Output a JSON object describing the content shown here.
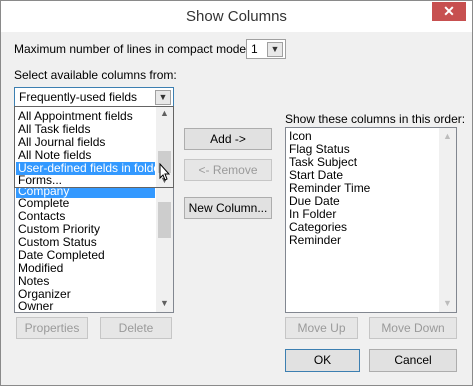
{
  "window": {
    "title": "Show Columns",
    "close_glyph": "✕"
  },
  "compact": {
    "label": "Maximum number of lines in compact mode:",
    "value": "1"
  },
  "source": {
    "label": "Select available columns from:",
    "selected": "Frequently-used fields",
    "options": [
      "All Appointment fields",
      "All Task fields",
      "All Journal fields",
      "All Note fields",
      "User-defined fields in folder",
      "Forms..."
    ],
    "highlighted_index": 4
  },
  "available": {
    "items": [
      "Company",
      "Complete",
      "Contacts",
      "Custom Priority",
      "Custom Status",
      "Date Completed",
      "Modified",
      "Notes",
      "Organizer",
      "Owner"
    ]
  },
  "actions": {
    "add": "Add ->",
    "remove": "<- Remove",
    "new_column": "New Column..."
  },
  "shown": {
    "label": "Show these columns in this order:",
    "items": [
      "Icon",
      "Flag Status",
      "Task Subject",
      "Start Date",
      "Reminder Time",
      "Due Date",
      "In Folder",
      "Categories",
      "Reminder"
    ]
  },
  "footer": {
    "properties": "Properties",
    "delete": "Delete",
    "move_up": "Move Up",
    "move_down": "Move Down",
    "ok": "OK",
    "cancel": "Cancel"
  }
}
